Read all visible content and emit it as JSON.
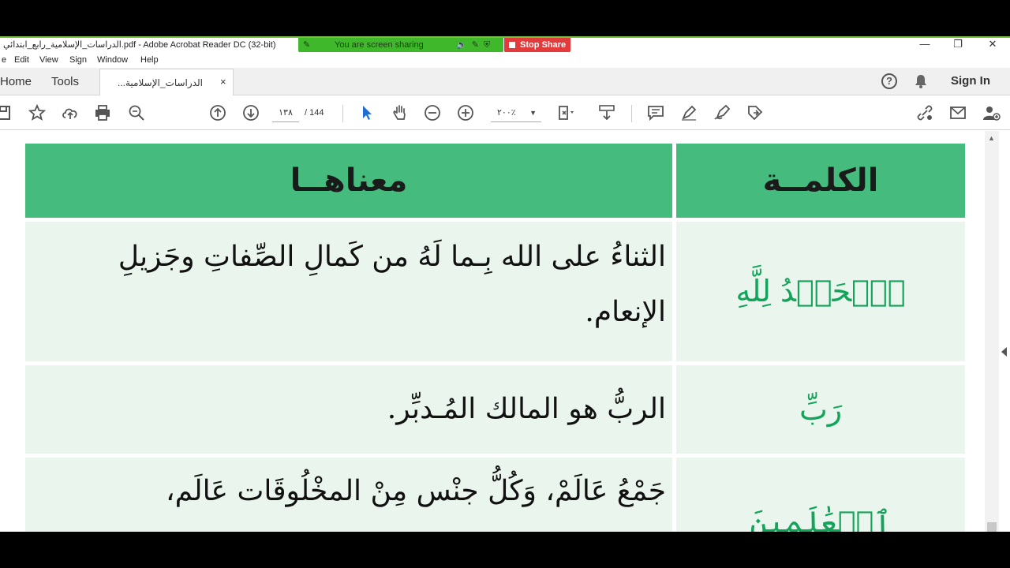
{
  "window": {
    "title": "الدراسات_الإسلامية_رابع_ابتدائي.pdf - Adobe Acrobat Reader DC (32-bit)",
    "minimize": "—",
    "restore": "❐",
    "close": "✕"
  },
  "screen_share": {
    "message": "You are screen sharing",
    "stop_label": "Stop Share"
  },
  "menu": [
    "e",
    "Edit",
    "View",
    "Sign",
    "Window",
    "Help"
  ],
  "tabs": {
    "home": "Home",
    "tools": "Tools",
    "document": "الدراسات_الإسلامية...",
    "close": "×"
  },
  "header_right": {
    "help": "?",
    "sign_in": "Sign In"
  },
  "toolbar": {
    "page_current": "١٣٨",
    "page_total": "/ 144",
    "zoom": "٢٠٠٪",
    "zoom_caret": "▼"
  },
  "colors": {
    "header_green": "#45bb7e",
    "row_bg": "#eaf5ee",
    "word_green": "#14a35a",
    "share_green": "#3fb82c",
    "stop_red": "#e33b3b"
  },
  "table": {
    "headers": {
      "meaning": "معناهــا",
      "word": "الكلمــة"
    },
    "rows": [
      {
        "word": "ٱلۡحَمۡدُ لِلَّهِ",
        "meaning_line1": "الثناءُ على الله بِـما لَهُ من كَمالِ الصِّفاتِ وجَزيلِ",
        "meaning_line2": "الإنعام."
      },
      {
        "word": "رَبِّ",
        "meaning_line1": "الربُّ هو المالك المُـدبِّر."
      },
      {
        "word": "ٱلۡعَٰلَمِينَ",
        "meaning_line1": "جَمْعُ عَالَمْ، وَكُلُّ جنْس مِنْ المخْلُوقَات عَالَم،"
      }
    ]
  }
}
